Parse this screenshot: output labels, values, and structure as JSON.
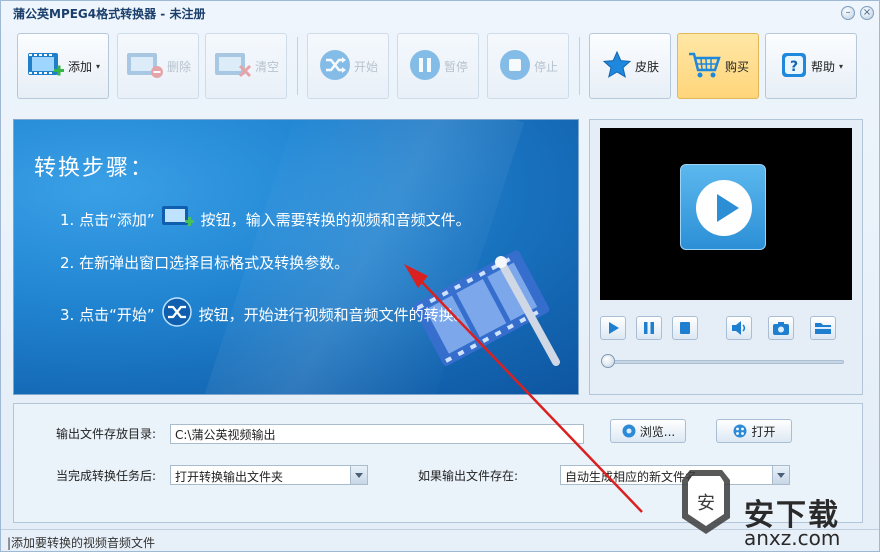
{
  "window": {
    "title": "蒲公英MPEG4格式转换器 - 未注册",
    "minimize_glyph": "–",
    "close_glyph": "×"
  },
  "toolbar": {
    "add_label": "添加",
    "delete_label": "删除",
    "clear_label": "清空",
    "start_label": "开始",
    "pause_label": "暂停",
    "stop_label": "停止",
    "skin_label": "皮肤",
    "buy_label": "购买",
    "help_label": "帮助",
    "dropdown_caret": "▾"
  },
  "banner": {
    "heading": "转换步骤：",
    "step1_before": "1. 点击“添加”",
    "step1_after": "按钮，输入需要转换的视频和音频文件。",
    "step2": "2. 在新弹出窗口选择目标格式及转换参数。",
    "step3_before": "3. 点击“开始”",
    "step3_after": "按钮，开始进行视频和音频文件的转换。"
  },
  "player": {
    "position_fraction": 0.0
  },
  "settings": {
    "output_dir_label": "输出文件存放目录:",
    "output_dir_value": "C:\\蒲公英视频输出",
    "browse_label": "浏览...",
    "open_label": "打开",
    "after_task_label": "当完成转换任务后:",
    "after_task_value": "打开转换输出文件夹",
    "if_exists_label": "如果输出文件存在:",
    "if_exists_value": "自动生成相应的新文件名"
  },
  "status": {
    "text": "|添加要转换的视频音频文件"
  },
  "watermark": {
    "text": "安下载",
    "sub": "anxz.com"
  },
  "colors": {
    "accent": "#2286d3",
    "highlight": "#ffd57a",
    "annotation_arrow": "#d92121"
  }
}
